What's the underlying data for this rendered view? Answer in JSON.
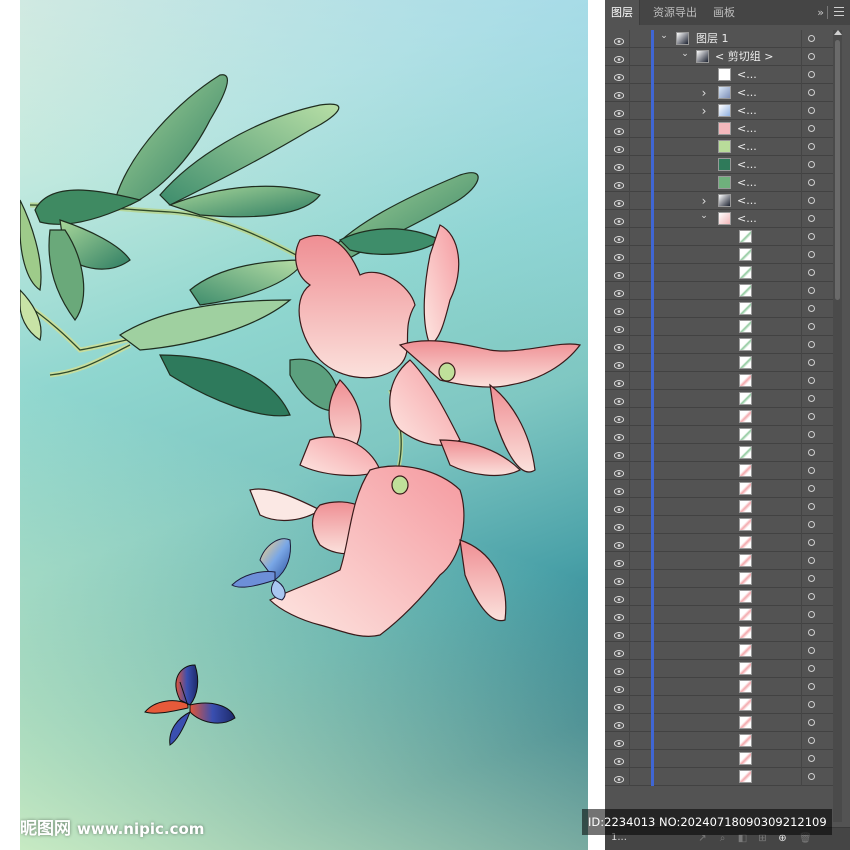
{
  "artwork": {
    "watermark_logo": "昵图网",
    "watermark_url": "www.nipic.com"
  },
  "layers_panel": {
    "tabs": [
      {
        "label": "图层",
        "active": true
      },
      {
        "label": "资源导出",
        "active": false
      },
      {
        "label": "画板",
        "active": false
      }
    ],
    "more_glyph": "»",
    "top_layer": {
      "name": "图层 1",
      "expanded": true
    },
    "clip_group": {
      "name": "< 剪切组 >",
      "expanded": true
    },
    "sublayers": [
      {
        "name": "<...",
        "caret": "",
        "thumb": "white-frame"
      },
      {
        "name": "<...",
        "caret": "collapsed",
        "thumb": "flower"
      },
      {
        "name": "<...",
        "caret": "collapsed",
        "thumb": "butterfly"
      },
      {
        "name": "<...",
        "caret": "",
        "thumb": "pink"
      },
      {
        "name": "<...",
        "caret": "",
        "thumb": "lightgreen"
      },
      {
        "name": "<...",
        "caret": "",
        "thumb": "darkgreen"
      },
      {
        "name": "<...",
        "caret": "",
        "thumb": "green"
      },
      {
        "name": "<...",
        "caret": "collapsed",
        "thumb": "dark-butterfly"
      },
      {
        "name": "<...",
        "caret": "expanded",
        "thumb": "plant"
      }
    ],
    "path_thumbs": [
      "leaf",
      "leaf",
      "leaf",
      "leaf",
      "leaf",
      "leaf",
      "leaf",
      "leaf",
      "petal",
      "leaf",
      "petal",
      "leaf",
      "leaf",
      "petal",
      "petal",
      "petal",
      "petal",
      "petal",
      "petal",
      "petal",
      "petal",
      "petal",
      "petal",
      "petal",
      "petal",
      "petal",
      "petal",
      "petal",
      "petal",
      "petal",
      "petal"
    ],
    "layer_count": "1...",
    "colors": {
      "panel_bg": "#535353",
      "tab_bg": "#454545",
      "layer_color_bar": "#3f66d4"
    }
  },
  "id_overlay": "ID:2234013 NO:20240718090309212109"
}
